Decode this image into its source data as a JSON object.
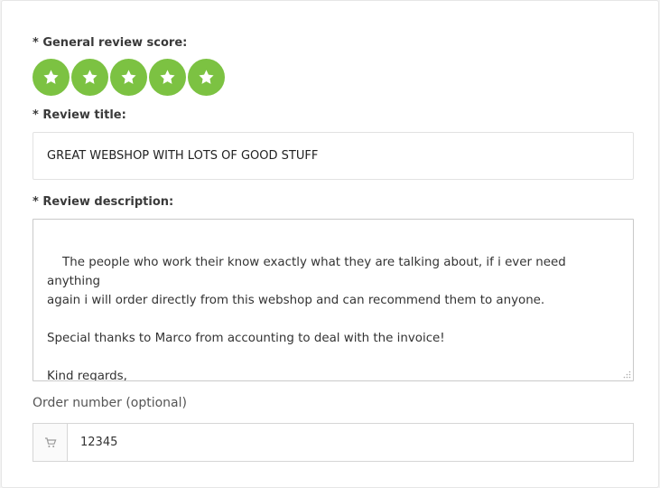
{
  "form": {
    "score_label": "* General review score:",
    "score": {
      "value": 5,
      "max": 5
    },
    "star_color": "#7cc242",
    "title_label": "* Review title:",
    "title_value": "GREAT WEBSHOP WITH LOTS OF GOOD STUFF",
    "description_label": "* Review description:",
    "description_value": "The people who work their know exactly what they are talking about, if i ever need anything\nagain i will order directly from this webshop and can recommend them to anyone.\n\nSpecial thanks to Marco from accounting to deal with the invoice!\n\nKind regards,\nJohn",
    "order_label": "Order number (optional)",
    "order_icon": "cart-icon",
    "order_value": "12345"
  }
}
